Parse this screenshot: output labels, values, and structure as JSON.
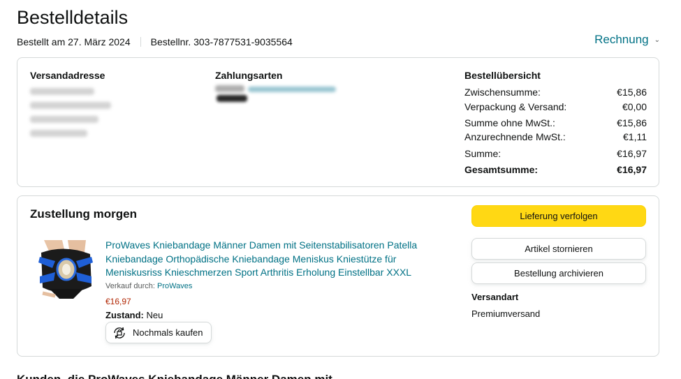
{
  "header": {
    "title": "Bestelldetails",
    "order_date": "Bestellt am 27. März 2024",
    "order_number": "Bestellnr. 303-7877531-9035564",
    "invoice_label": "Rechnung"
  },
  "summary_card": {
    "shipping_address_title": "Versandadresse",
    "payment_title": "Zahlungsarten",
    "overview_title": "Bestellübersicht",
    "rows": [
      {
        "label": "Zwischensumme:",
        "value": "€15,86"
      },
      {
        "label": "Verpackung & Versand:",
        "value": "€0,00"
      },
      {
        "label": "Summe ohne MwSt.:",
        "value": "€15,86"
      },
      {
        "label": "Anzurechnende MwSt.:",
        "value": "€1,11"
      },
      {
        "label": "Summe:",
        "value": "€16,97"
      },
      {
        "label": "Gesamtsumme:",
        "value": "€16,97"
      }
    ]
  },
  "delivery": {
    "title": "Zustellung morgen",
    "product": {
      "title": "ProWaves Kniebandage Männer Damen mit Seitenstabilisatoren Patella Kniebandage Orthopädische Kniebandage Meniskus Kniestütze für Meniskusriss Knieschmerzen Sport Arthritis Erholung Einstellbar XXXL",
      "seller_prefix": "Verkauf durch:",
      "seller": "ProWaves",
      "price": "€16,97",
      "condition_label": "Zustand:",
      "condition_value": "Neu",
      "buy_again": "Nochmals kaufen"
    },
    "actions": {
      "track": "Lieferung verfolgen",
      "cancel": "Artikel stornieren",
      "archive": "Bestellung archivieren"
    },
    "shipping_label": "Versandart",
    "shipping_value": "Premiumversand"
  },
  "bottom": {
    "heading": "Kunden, die ProWaves Kniebandage Männer Damen mit"
  },
  "colors": {
    "link": "#007185",
    "price": "#b12704",
    "primary_button": "#ffd814",
    "border": "#d5d9d9"
  }
}
